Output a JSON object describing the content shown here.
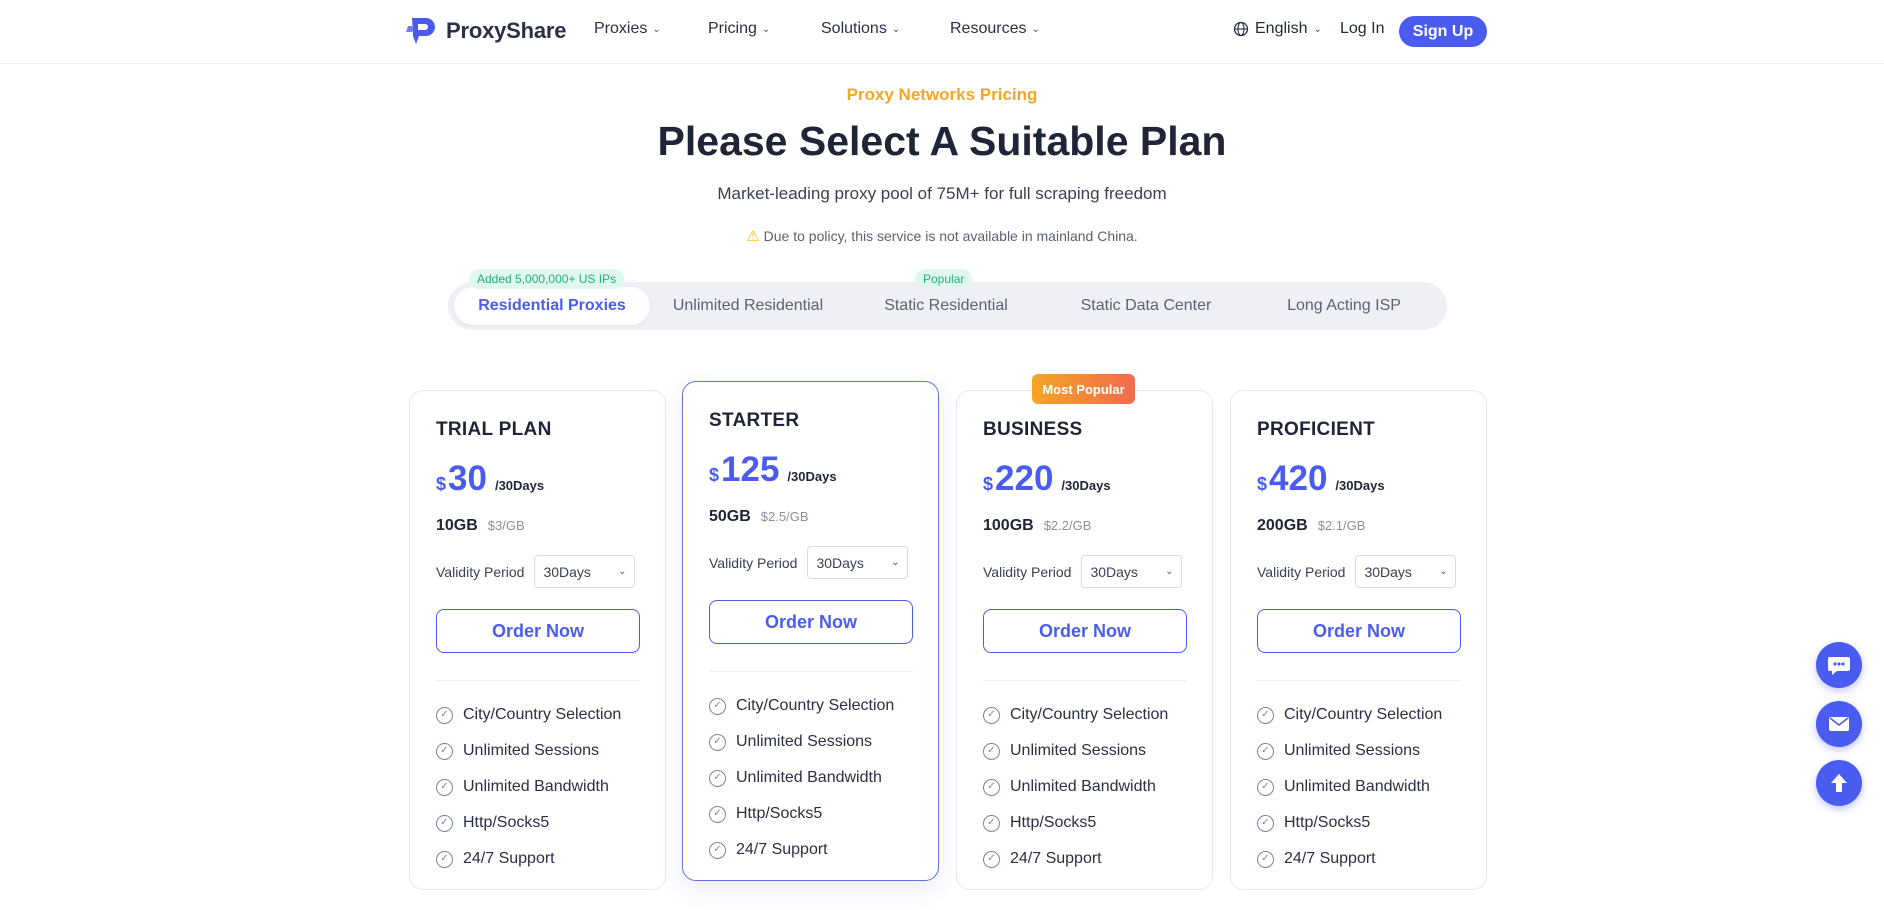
{
  "nav": {
    "brand": "ProxyShare",
    "items": [
      {
        "label": "Proxies"
      },
      {
        "label": "Pricing"
      },
      {
        "label": "Solutions"
      },
      {
        "label": "Resources"
      }
    ],
    "language": "English",
    "login": "Log In",
    "signup": "Sign Up"
  },
  "hero": {
    "eyebrow": "Proxy Networks Pricing",
    "title": "Please Select A Suitable Plan",
    "subtitle": "Market-leading proxy pool of 75M+ for full scraping freedom",
    "notice": "Due to policy, this service is not available in mainland China."
  },
  "tabs": [
    {
      "label": "Residential Proxies",
      "badge": "Added 5,000,000+ US IPs",
      "active": true
    },
    {
      "label": "Unlimited Residential"
    },
    {
      "label": "Static Residential",
      "badge": "Popular"
    },
    {
      "label": "Static Data Center"
    },
    {
      "label": "Long Acting ISP"
    }
  ],
  "plans": [
    {
      "name": "TRIAL PLAN",
      "currency": "$",
      "price": "30",
      "period": "/30Days",
      "data": "10GB",
      "per_gb": "$3/GB",
      "validity_label": "Validity Period",
      "validity": "30Days",
      "cta": "Order Now"
    },
    {
      "name": "STARTER",
      "currency": "$",
      "price": "125",
      "period": "/30Days",
      "data": "50GB",
      "per_gb": "$2.5/GB",
      "validity_label": "Validity Period",
      "validity": "30Days",
      "cta": "Order Now",
      "featured": true
    },
    {
      "name": "BUSINESS",
      "currency": "$",
      "price": "220",
      "period": "/30Days",
      "data": "100GB",
      "per_gb": "$2.2/GB",
      "validity_label": "Validity Period",
      "validity": "30Days",
      "cta": "Order Now",
      "badge": "Most Popular"
    },
    {
      "name": "PROFICIENT",
      "currency": "$",
      "price": "420",
      "period": "/30Days",
      "data": "200GB",
      "per_gb": "$2.1/GB",
      "validity_label": "Validity Period",
      "validity": "30Days",
      "cta": "Order Now"
    }
  ],
  "features": [
    "City/Country Selection",
    "Unlimited Sessions",
    "Unlimited Bandwidth",
    "Http/Socks5",
    "24/7 Support"
  ],
  "floating": [
    "chat-icon",
    "mail-icon",
    "arrow-up-icon"
  ],
  "colors": {
    "accent": "#4a5cf0",
    "eyebrow": "#f5a524",
    "badge_green": "#22b07d"
  }
}
